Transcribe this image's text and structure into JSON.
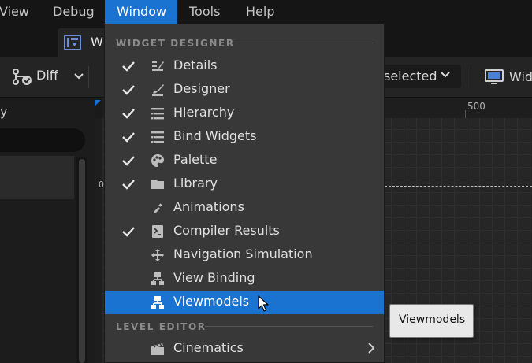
{
  "menubar": {
    "items": [
      {
        "label": "View"
      },
      {
        "label": "Debug"
      },
      {
        "label": "Window"
      },
      {
        "label": "Tools"
      },
      {
        "label": "Help"
      }
    ],
    "active_index": 2,
    "active_color": "#1a72d1"
  },
  "tab": {
    "label": "WI"
  },
  "toolbar": {
    "diff_label": "Diff",
    "selected_dropdown": "selected",
    "widget_label": "Wid"
  },
  "left_panel": {
    "title_fragment": "y"
  },
  "canvas": {
    "ruler_top_label": "500",
    "ruler_left_label": "0"
  },
  "dropdown": {
    "section_1": "WIDGET DESIGNER",
    "section_2": "LEVEL EDITOR",
    "items": [
      {
        "label": "Details",
        "checked": true,
        "icon": "details-icon"
      },
      {
        "label": "Designer",
        "checked": true,
        "icon": "designer-icon"
      },
      {
        "label": "Hierarchy",
        "checked": true,
        "icon": "hierarchy-icon"
      },
      {
        "label": "Bind Widgets",
        "checked": true,
        "icon": "bind-widgets-icon"
      },
      {
        "label": "Palette",
        "checked": true,
        "icon": "palette-icon"
      },
      {
        "label": "Library",
        "checked": true,
        "icon": "library-folder-icon"
      },
      {
        "label": "Animations",
        "checked": false,
        "icon": "animations-icon"
      },
      {
        "label": "Compiler Results",
        "checked": true,
        "icon": "compiler-results-icon"
      },
      {
        "label": "Navigation Simulation",
        "checked": false,
        "icon": "navigation-simulation-icon"
      },
      {
        "label": "View Binding",
        "checked": false,
        "icon": "view-binding-icon"
      },
      {
        "label": "Viewmodels",
        "checked": false,
        "icon": "viewmodels-icon",
        "highlighted": true
      }
    ],
    "level_editor_items": [
      {
        "label": "Cinematics",
        "icon": "cinematics-icon",
        "has_submenu": true
      }
    ],
    "highlight_color": "#1a72d1"
  },
  "tooltip": {
    "text": "Viewmodels"
  }
}
